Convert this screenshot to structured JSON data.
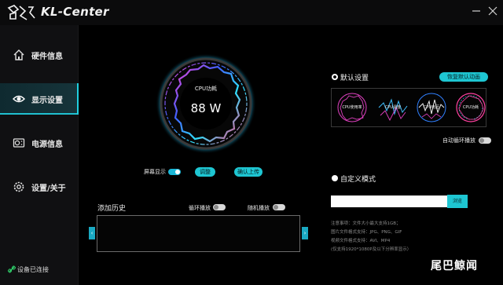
{
  "app": {
    "title": "KL-Center",
    "logo_icon": "kl-logo-icon"
  },
  "window": {
    "minimize_icon": "minimize-icon",
    "close_icon": "close-icon"
  },
  "sidebar": {
    "items": [
      {
        "label": "硬件信息",
        "icon": "home-icon",
        "active": false
      },
      {
        "label": "显示设置",
        "icon": "eye-icon",
        "active": true
      },
      {
        "label": "电源信息",
        "icon": "power-supply-icon",
        "active": false
      },
      {
        "label": "设置/关于",
        "icon": "gear-icon",
        "active": false
      }
    ],
    "connection_status": "设备已连接",
    "connection_icon": "link-icon"
  },
  "display": {
    "metric_label": "CPU功耗",
    "metric_value": "88 W",
    "screen_display_label": "屏幕显示",
    "screen_display_on": true,
    "adjust_button": "调整",
    "confirm_upload_button": "确认上传"
  },
  "history": {
    "title": "添加历史",
    "loop_play_label": "循环播放",
    "loop_play_on": false,
    "random_play_label": "随机播放",
    "random_play_on": false,
    "prev_arrow": "‹",
    "next_arrow": "›"
  },
  "default_settings": {
    "title": "默认设置",
    "restore_button": "恢复默认动画",
    "presets": [
      {
        "label": "CPU使用率",
        "color": "#e040c0"
      },
      {
        "label": "CPU温度",
        "color": "#40c0ff"
      },
      {
        "label": "CPU电压",
        "color": "#ffffff"
      },
      {
        "label": "CPU功耗",
        "color": "#ff40a0"
      }
    ],
    "auto_loop_label": "自动循环播放",
    "auto_loop_on": false
  },
  "custom_mode": {
    "title": "自定义模式",
    "file_path": "",
    "browse_button": "浏览",
    "notes": [
      "注意事项：文件大小最大支持1GB；",
      "图片文件格式支持：JPG、PNG、GIF",
      "视频文件格式支持：AVI、MP4",
      "(仅支持1920*1080P及以下分辨率显示）"
    ]
  },
  "watermark": "尾巴鲸闻",
  "colors": {
    "accent": "#1ec6d2",
    "sidebar_bg": "#101012",
    "active_bg": "#16343a"
  }
}
